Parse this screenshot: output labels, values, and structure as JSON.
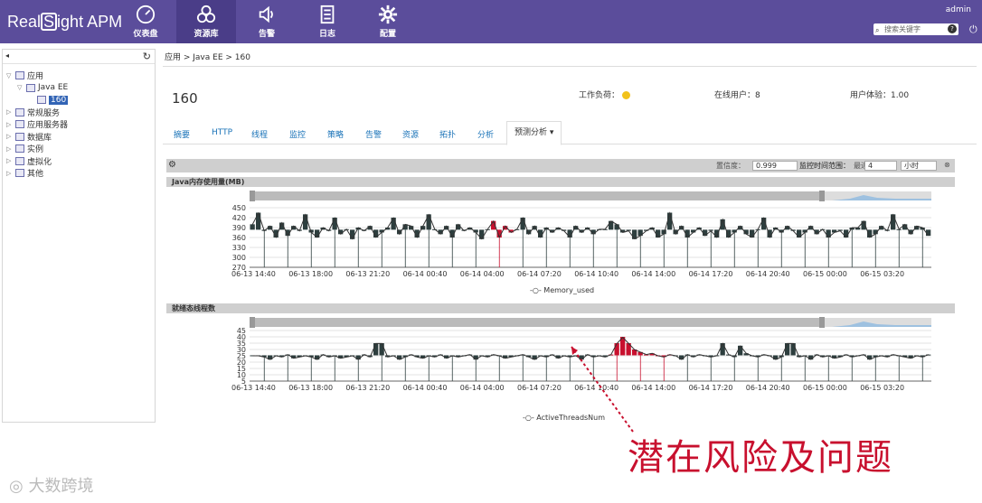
{
  "app": {
    "logo_pre": "Real",
    "logo_s": "S",
    "logo_post": "ight APM",
    "user": "admin",
    "search_placeholder": "搜索关键字"
  },
  "nav": [
    {
      "label": "仪表盘",
      "icon": "dashboard-icon"
    },
    {
      "label": "资源库",
      "icon": "cluster-icon"
    },
    {
      "label": "告警",
      "icon": "alarm-icon"
    },
    {
      "label": "日志",
      "icon": "log-icon"
    },
    {
      "label": "配置",
      "icon": "gear-icon"
    }
  ],
  "tree": [
    {
      "label": "应用",
      "depth": 0,
      "toggle": "▽"
    },
    {
      "label": "Java EE",
      "depth": 1,
      "toggle": "▽"
    },
    {
      "label": "160",
      "depth": 2,
      "selected": true
    },
    {
      "label": "常规服务",
      "depth": 0,
      "toggle": "▷"
    },
    {
      "label": "应用服务器",
      "depth": 0,
      "toggle": "▷"
    },
    {
      "label": "数据库",
      "depth": 0,
      "toggle": "▷"
    },
    {
      "label": "实例",
      "depth": 0,
      "toggle": "▷"
    },
    {
      "label": "虚拟化",
      "depth": 0,
      "toggle": "▷"
    },
    {
      "label": "其他",
      "depth": 0,
      "toggle": "▷"
    }
  ],
  "main": {
    "breadcrumb": "应用 > Java EE > 160",
    "title": "160",
    "workload_label": "工作负荷：",
    "online_users": "在线用户：8",
    "user_experience": "用户体验：1.00",
    "tabs": [
      "摘要",
      "HTTP",
      "线程",
      "监控",
      "策略",
      "告警",
      "资源",
      "拓扑",
      "分析",
      "预测分析"
    ],
    "toolbar": {
      "level_label": "置信度：",
      "level_value": "0.999",
      "range_label": "监控时间范围：",
      "last_label": "最近",
      "last_value": "4",
      "unit_value": "小时"
    }
  },
  "chart_data": [
    {
      "type": "bar",
      "title": "Java内存使用量(MB)",
      "legend": "Memory_used",
      "yticks": [
        270,
        300,
        330,
        360,
        390,
        420,
        450
      ],
      "ylim": [
        270,
        450
      ],
      "xticks": [
        "06-13 14:40",
        "06-13 18:00",
        "06-13 21:20",
        "06-14 00:40",
        "06-14 04:00",
        "06-14 07:20",
        "06-14 10:40",
        "06-14 14:00",
        "06-14 17:20",
        "06-14 20:40",
        "06-15 00:00",
        "06-15 03:20"
      ],
      "values": [
        400,
        435,
        380,
        395,
        360,
        405,
        365,
        395,
        380,
        430,
        375,
        360,
        390,
        380,
        420,
        370,
        385,
        355,
        390,
        380,
        395,
        360,
        375,
        390,
        420,
        370,
        400,
        395,
        360,
        395,
        430,
        385,
        370,
        395,
        360,
        400,
        380,
        390,
        375,
        355,
        385,
        410,
        360,
        395,
        375,
        385,
        420,
        370,
        395,
        360,
        390,
        375,
        390,
        380,
        360,
        395,
        375,
        390,
        370,
        385,
        385,
        410,
        400,
        375,
        380,
        355,
        365,
        380,
        390,
        360,
        370,
        435,
        370,
        395,
        360,
        375,
        390,
        365,
        380,
        360,
        415,
        360,
        375,
        395,
        370,
        360,
        385,
        420,
        360,
        390,
        375,
        395,
        380,
        360,
        375,
        395,
        370,
        385,
        360,
        375,
        380,
        360,
        390,
        390,
        410,
        360,
        370,
        395,
        380,
        430,
        385,
        400,
        370,
        395,
        390,
        365
      ],
      "risk_range": [
        41,
        44
      ]
    },
    {
      "type": "bar",
      "title": "就绪态线程数",
      "legend": "ActiveThreadsNum",
      "yticks": [
        5,
        10,
        15,
        20,
        25,
        30,
        35,
        40,
        45
      ],
      "ylim": [
        5,
        45
      ],
      "xticks": [
        "06-13 14:40",
        "06-13 18:00",
        "06-13 21:20",
        "06-14 00:40",
        "06-14 04:00",
        "06-14 07:20",
        "06-14 10:40",
        "06-14 14:00",
        "06-14 17:20",
        "06-14 20:40",
        "06-15 00:00",
        "06-15 03:20"
      ],
      "values": [
        25,
        25,
        24,
        22,
        25,
        24,
        26,
        23,
        24,
        25,
        24,
        22,
        26,
        24,
        25,
        23,
        24,
        25,
        22,
        26,
        24,
        35,
        35,
        24,
        25,
        22,
        24,
        26,
        24,
        23,
        25,
        24,
        26,
        23,
        25,
        24,
        25,
        26,
        22,
        25,
        24,
        26,
        25,
        23,
        24,
        25,
        26,
        24,
        22,
        25,
        24,
        26,
        23,
        25,
        24,
        25,
        22,
        26,
        24,
        25,
        24,
        26,
        35,
        40,
        35,
        30,
        28,
        26,
        27,
        25,
        24,
        26,
        25,
        22,
        26,
        24,
        26,
        25,
        24,
        25,
        35,
        26,
        24,
        33,
        27,
        25,
        24,
        26,
        25,
        22,
        24,
        35,
        35,
        24,
        25,
        22,
        26,
        24,
        25,
        23,
        24,
        26,
        24,
        25,
        26,
        22,
        24,
        25,
        24,
        26,
        25,
        24,
        23,
        25,
        24,
        26
      ],
      "risk_range": [
        61,
        71
      ]
    }
  ],
  "annotation": "潜在风险及问题",
  "watermark": "大数跨境"
}
